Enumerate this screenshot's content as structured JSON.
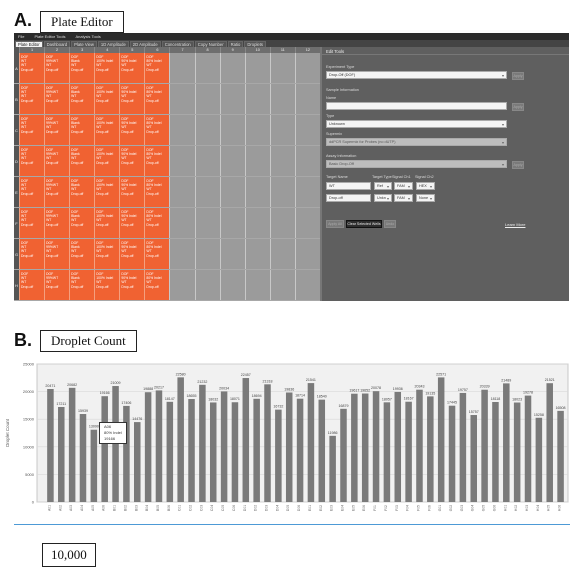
{
  "panel_a": {
    "letter": "A.",
    "caption": "Plate Editor",
    "menubar": [
      "File",
      "Plate Editor Tools",
      "Analysis Tools"
    ],
    "tabs": [
      {
        "label": "Plate Editor",
        "active": true
      },
      {
        "label": "Dashboard",
        "active": false
      },
      {
        "label": "Plate View",
        "active": false
      },
      {
        "label": "1D Amplitude",
        "active": false
      },
      {
        "label": "2D Amplitude",
        "active": false
      },
      {
        "label": "Concentration",
        "active": false
      },
      {
        "label": "Copy Number",
        "active": false
      },
      {
        "label": "Ratio",
        "active": false
      },
      {
        "label": "Droplets",
        "active": false
      }
    ],
    "plate": {
      "columns": [
        "1",
        "2",
        "3",
        "4",
        "5",
        "6",
        "7",
        "8",
        "9",
        "10",
        "11",
        "12"
      ],
      "rows": [
        "A",
        "B",
        "C",
        "D",
        "E",
        "F",
        "G",
        "H"
      ],
      "filled_columns": 6,
      "well_template": [
        [
          "DOF",
          "WT",
          "WT",
          "Drop-off"
        ],
        [
          "DOF",
          "99%WT",
          "WT",
          "Drop-off"
        ],
        [
          "DOF",
          "Blank",
          "WT",
          "Drop-off"
        ],
        [
          "DOF",
          "100% Indel",
          "WT",
          "Drop-off"
        ],
        [
          "DOF",
          "90% Indel",
          "WT",
          "Drop-off"
        ],
        [
          "DOF",
          "80% Indel",
          "WT",
          "Drop-off"
        ]
      ],
      "filled_color": "#f06232"
    },
    "edit_panel": {
      "title": "Edit Tools",
      "experiment_type_label": "Experiment Type",
      "experiment_type_value": "Drop-Off (DOF)",
      "apply_label": "Apply",
      "sample_info_label": "Sample Information",
      "name_label": "Name",
      "name_value": "",
      "type_label": "Type",
      "type_value": "Unknown",
      "supermix_label": "Supermix",
      "supermix_value": "ddPCR Supermix for Probes (no dUTP)",
      "assay_info_label": "Assay Information",
      "assay_value": "Basic Drop-Off",
      "target_headers": [
        "Target Name",
        "Target Type",
        "Signal Ch1",
        "Signal Ch2"
      ],
      "targets": [
        {
          "name": "WT",
          "type": "Ref",
          "ch1": "FAM",
          "ch2": "HEX"
        },
        {
          "name": "Drop-off",
          "type": "Unkn",
          "ch1": "FAM",
          "ch2": "None"
        }
      ],
      "apply_all_label": "Apply All",
      "clear_label": "Clear Selected Wells",
      "undo_label": "Undo",
      "learn_more_label": "Learn More"
    }
  },
  "panel_b": {
    "letter": "B.",
    "caption": "Droplet Count",
    "tooltip": {
      "well": "A06",
      "sample": "80% Indel",
      "value": "19166"
    }
  },
  "bottom_caption": "10,000",
  "chart_data": {
    "type": "bar",
    "title": "",
    "xlabel": "",
    "ylabel": "Droplet Count",
    "ylim": [
      0,
      25000
    ],
    "yticks": [
      0,
      5000,
      10000,
      15000,
      20000,
      25000
    ],
    "grid": true,
    "bar_color": "#7a7a7a",
    "categories": [
      "A01",
      "A02",
      "A03",
      "A04",
      "A05",
      "A06",
      "B01",
      "B02",
      "B03",
      "B04",
      "B05",
      "B06",
      "C01",
      "C02",
      "C03",
      "C04",
      "C05",
      "C06",
      "D01",
      "D02",
      "D03",
      "D04",
      "D05",
      "D06",
      "E01",
      "E02",
      "E03",
      "E04",
      "E05",
      "E06",
      "F01",
      "F02",
      "F03",
      "F04",
      "F05",
      "F06",
      "G01",
      "G02",
      "G03",
      "G04",
      "G05",
      "G06",
      "H01",
      "H02",
      "H03",
      "H04",
      "H05",
      "H06"
    ],
    "values": [
      20471,
      17211,
      20682,
      15939,
      13090,
      19166,
      21009,
      17406,
      14476,
      19888,
      20217,
      18147,
      22580,
      18655,
      21232,
      18032,
      20034,
      18071,
      22457,
      18694,
      21318,
      16732,
      19836,
      18714,
      21541,
      18540,
      11986,
      16879,
      19617,
      19652,
      20078,
      18057,
      19936,
      18167,
      20343,
      19135,
      22571,
      17445,
      19757,
      15757,
      20339,
      18118,
      21489,
      18023,
      19278,
      15258,
      21521,
      16508
    ]
  }
}
